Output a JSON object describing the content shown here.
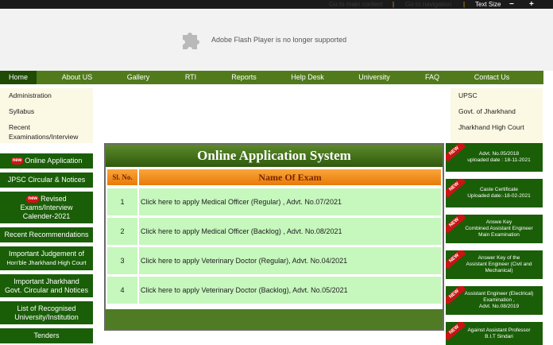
{
  "topbar": {
    "skip_main": "Go to main content",
    "skip_nav": "Go to navigation",
    "separator": "|",
    "text_size_label": "Text Size",
    "decrease": "−",
    "increase": "+"
  },
  "banner": {
    "message": "Adobe Flash Player is no longer supported",
    "icon": "plugin-icon"
  },
  "nav": {
    "items": [
      "Home",
      "About US",
      "Gallery",
      "RTI",
      "Reports",
      "Help Desk",
      "University",
      "FAQ",
      "Contact Us"
    ],
    "active": "Home"
  },
  "left_sidebar": {
    "links": [
      "Administration",
      "Syllabus",
      "Recent",
      "Examinations/Interview"
    ],
    "buttons": {
      "online_application": "Online Application",
      "circular": "JPSC Circular & Notices",
      "revised_1": "Revised",
      "revised_2": "Exams/Interview",
      "revised_3": "Calender-2021",
      "recent_recommendations": "Recent Recommendations",
      "judgement_1": "Important Judgement of",
      "judgement_2": "Hon'ble Jharkhand High Court",
      "govt_1": "Important Jharkhand",
      "govt_2": "Govt. Circular and Notices",
      "univ_1": "List of Recognised",
      "univ_2": "University/Institution",
      "tenders": "Tenders"
    },
    "new_badge": "new"
  },
  "right_sidebar": {
    "links": [
      "UPSC",
      "Govt. of Jharkhand",
      "Jharkhand High Court"
    ],
    "ribbon": "NEW",
    "notices": [
      {
        "line1": "Advt. No.05/2018",
        "line2": "uploaded date : 18-11-2021",
        "line3": ""
      },
      {
        "line1": "Caste Certificate",
        "line2": "Uploaded date:-18-02-2021",
        "line3": ""
      },
      {
        "line1": "Answe Key",
        "line2": "Combined Assistant Engineer",
        "line3": "Main Examination"
      },
      {
        "line1": "Answer Key of the",
        "line2": "Assistant Engineer (Civil and",
        "line3": "Mechanical)"
      },
      {
        "line1": "Assistant Engineer (Electrical)",
        "line2": "Examination ,",
        "line3": "Advt. No.08/2019"
      },
      {
        "line1": "Against Assistant Professor",
        "line2": "B.I.T Sindari",
        "line3": ""
      }
    ]
  },
  "main": {
    "title": "Online Application System",
    "col_sl": "Sl. No.",
    "col_name": "Name Of Exam",
    "rows": [
      {
        "sl": "1",
        "name": "Click here to apply Medical Officer (Regular) , Advt. No.07/2021"
      },
      {
        "sl": "2",
        "name": "Click here to apply Medical Officer (Backlog) , Advt. No.08/2021"
      },
      {
        "sl": "3",
        "name": "Click here to apply Veterinary Doctor (Regular), Advt. No.04/2021"
      },
      {
        "sl": "4",
        "name": "Click here to apply Veterinary Doctor (Backlog), Advt. No.05/2021"
      }
    ]
  },
  "colors": {
    "nav_green": "#507a1c",
    "home_green": "#1f4b05",
    "button_green": "#1a5e08",
    "header_orange": "#f58a13",
    "row_green": "#c6f7bd"
  }
}
